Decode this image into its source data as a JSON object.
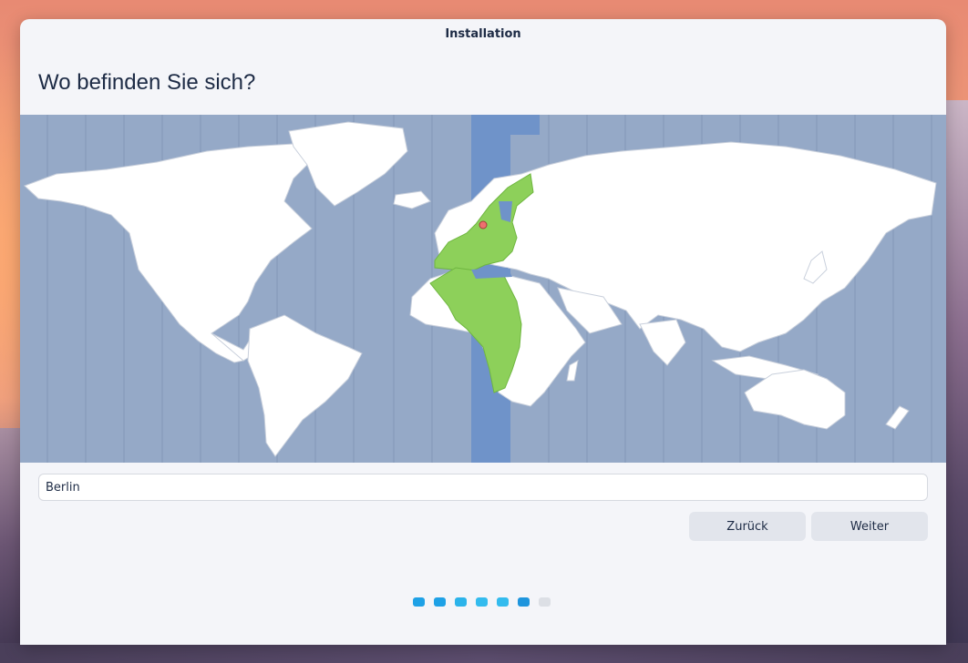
{
  "window": {
    "title": "Installation"
  },
  "page": {
    "heading": "Wo befinden Sie sich?"
  },
  "map": {
    "selected_city": "Berlin",
    "selected_timezone_color": "#6f93c9",
    "region_highlight_color": "#8dd05a",
    "ocean_color": "#95a9c7"
  },
  "timezone_input": {
    "value": "Berlin"
  },
  "buttons": {
    "back_label": "Zurück",
    "next_label": "Weiter"
  },
  "progress": {
    "total_steps": 7,
    "current_step": 6
  }
}
